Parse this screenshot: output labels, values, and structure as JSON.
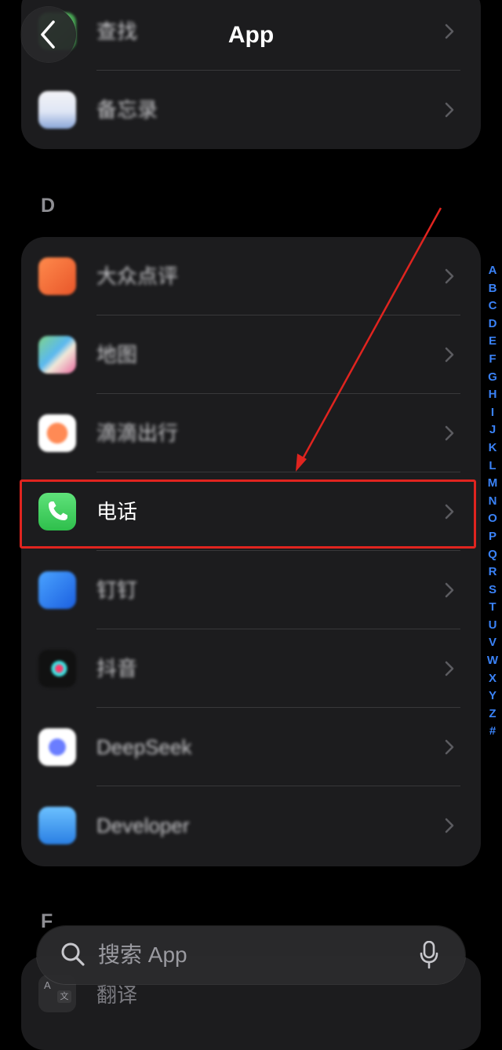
{
  "header": {
    "title": "App"
  },
  "top_group": {
    "items": [
      {
        "label": "查找",
        "icon": "find-my-icon",
        "blurred": true
      },
      {
        "label": "备忘录",
        "icon": "blurred-app-icon",
        "blurred": true
      }
    ]
  },
  "section_d": {
    "letter": "D",
    "items": [
      {
        "label": "大众点评",
        "icon": "dianping-icon",
        "blurred": true
      },
      {
        "label": "地图",
        "icon": "maps-icon",
        "blurred": true
      },
      {
        "label": "滴滴出行",
        "icon": "didi-icon",
        "blurred": true
      },
      {
        "label": "电话",
        "icon": "phone-icon",
        "blurred": false,
        "highlighted": true
      },
      {
        "label": "钉钉",
        "icon": "dingtalk-icon",
        "blurred": true
      },
      {
        "label": "抖音",
        "icon": "douyin-icon",
        "blurred": true
      },
      {
        "label": "DeepSeek",
        "icon": "deepseek-icon",
        "blurred": true
      },
      {
        "label": "Developer",
        "icon": "developer-icon",
        "blurred": true
      }
    ]
  },
  "section_f": {
    "letter": "F",
    "items": [
      {
        "label": "翻译",
        "icon": "translate-icon",
        "blurred": false
      }
    ]
  },
  "index_letters": [
    "A",
    "B",
    "C",
    "D",
    "E",
    "F",
    "G",
    "H",
    "I",
    "J",
    "K",
    "L",
    "M",
    "N",
    "O",
    "P",
    "Q",
    "R",
    "S",
    "T",
    "U",
    "V",
    "W",
    "X",
    "Y",
    "Z",
    "#"
  ],
  "search": {
    "placeholder": "搜索 App"
  },
  "annotation": {
    "color": "#e0241f"
  },
  "colors": {
    "accent": "#3a82f7",
    "phone_green": "#34c759"
  }
}
